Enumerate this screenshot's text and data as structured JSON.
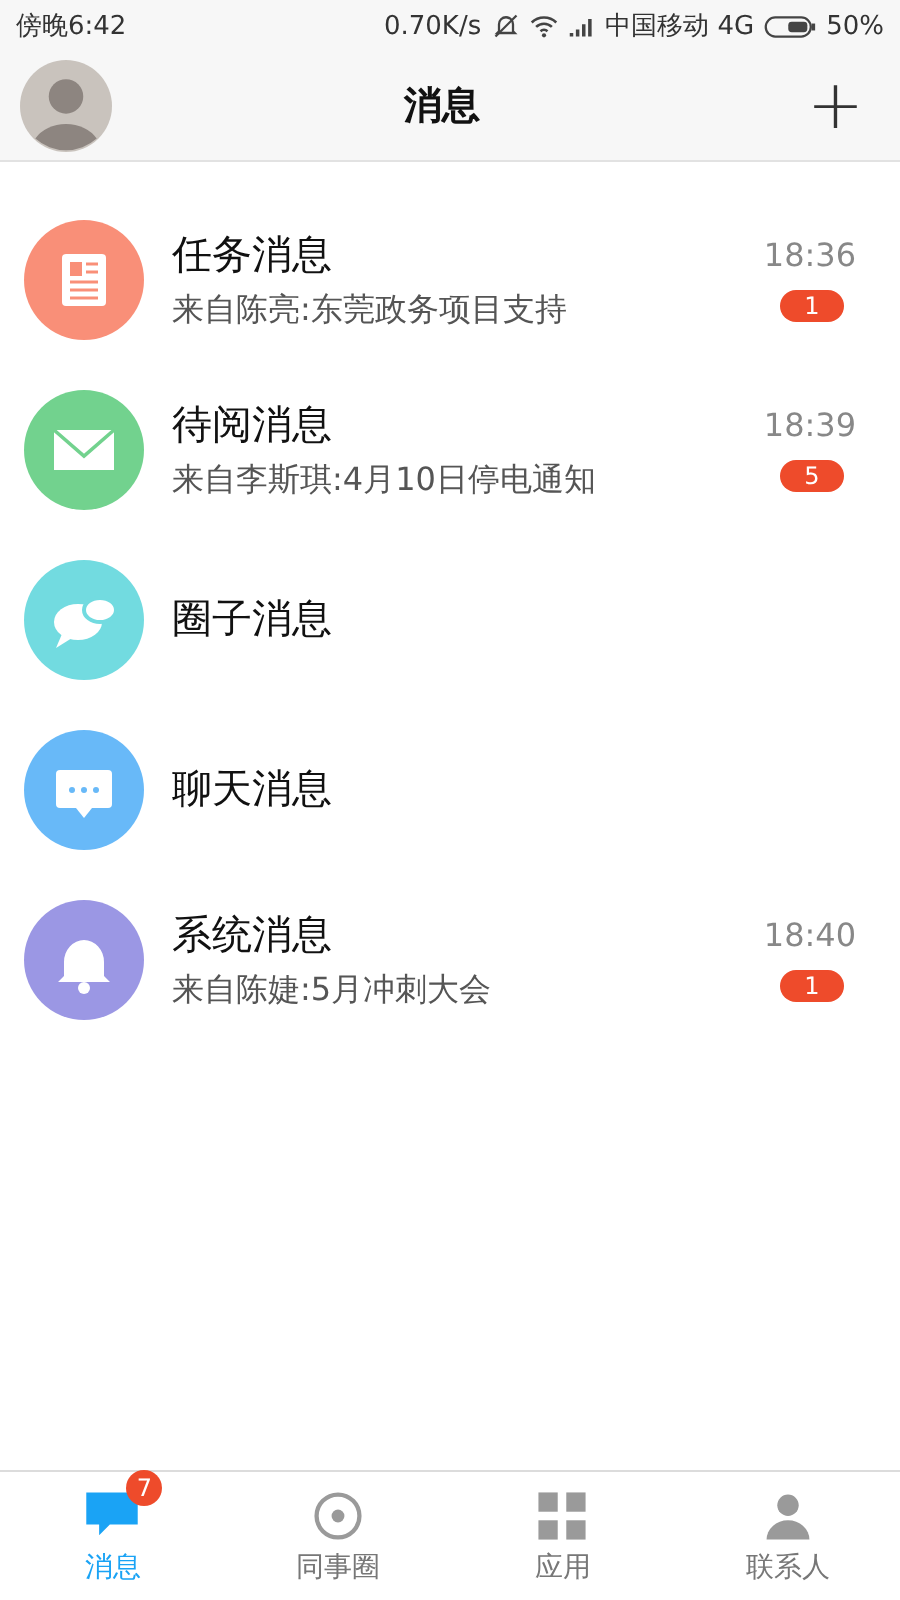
{
  "status_bar": {
    "time": "傍晚6:42",
    "speed": "0.70K/s",
    "carrier": "中国移动 4G",
    "battery": "50%"
  },
  "header": {
    "title": "消息",
    "add_button": "+"
  },
  "messages": [
    {
      "kind": "task",
      "title": "任务消息",
      "subtitle": "来自陈亮:东莞政务项目支持",
      "time": "18:36",
      "badge": "1",
      "color": "#f98f78"
    },
    {
      "kind": "mail",
      "title": "待阅消息",
      "subtitle": "来自李斯琪:4月10日停电通知",
      "time": "18:39",
      "badge": "5",
      "color": "#72d28e"
    },
    {
      "kind": "circle",
      "title": "圈子消息",
      "color": "#72dbe0"
    },
    {
      "kind": "chat",
      "title": "聊天消息",
      "color": "#68b9f8"
    },
    {
      "kind": "system",
      "title": "系统消息",
      "subtitle": "来自陈婕:5月冲刺大会",
      "time": "18:40",
      "badge": "1",
      "color": "#9b97e4"
    }
  ],
  "tabs": [
    {
      "kind": "messages",
      "label": "消息",
      "selected": true,
      "badge": "7"
    },
    {
      "kind": "colleagues",
      "label": "同事圈",
      "selected": false
    },
    {
      "kind": "apps",
      "label": "应用",
      "selected": false
    },
    {
      "kind": "contacts",
      "label": "联系人",
      "selected": false
    }
  ]
}
